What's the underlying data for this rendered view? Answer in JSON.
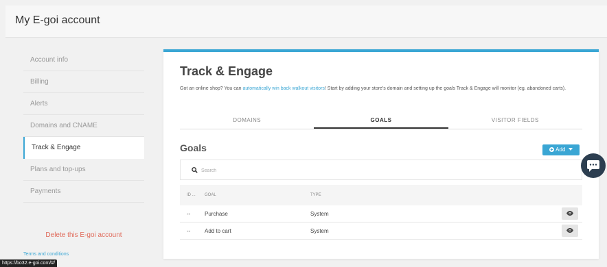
{
  "header": {
    "title": "My E-goi account"
  },
  "sidebar": {
    "items": [
      {
        "label": "Account info"
      },
      {
        "label": "Billing"
      },
      {
        "label": "Alerts"
      },
      {
        "label": "Domains and CNAME"
      },
      {
        "label": "Track & Engage"
      },
      {
        "label": "Plans and top-ups"
      },
      {
        "label": "Payments"
      }
    ],
    "active": "Track & Engage",
    "delete_label": "Delete this E-goi account",
    "terms_label": "Terms and conditions"
  },
  "status_bar": {
    "url": "https://bo32.e-goi.com/#/"
  },
  "panel": {
    "title": "Track & Engage",
    "desc_before": "Got an online shop? You can ",
    "desc_link": "automatically win back walkout visitors",
    "desc_after": "! Start by adding your store's domain and setting up the goals Track & Engage will monitor (eg. abandoned carts).",
    "tabs": [
      {
        "label": "DOMAINS"
      },
      {
        "label": "GOALS"
      },
      {
        "label": "VISITOR FIELDS"
      }
    ],
    "active_tab": "GOALS",
    "goals_heading": "Goals",
    "add_label": "Add",
    "search_placeholder": "Search",
    "table": {
      "columns": [
        "ID ...",
        "GOAL",
        "TYPE"
      ],
      "rows": [
        {
          "id": "--",
          "goal": "Purchase",
          "type": "System"
        },
        {
          "id": "--",
          "goal": "Add to cart",
          "type": "System"
        }
      ]
    }
  },
  "colors": {
    "accent": "#3aa6d4",
    "danger": "#e06a5a",
    "chat": "#2c3e50"
  },
  "icons": [
    "plus-circle-icon",
    "caret-down-icon",
    "search-icon",
    "eye-icon",
    "chat-icon"
  ]
}
